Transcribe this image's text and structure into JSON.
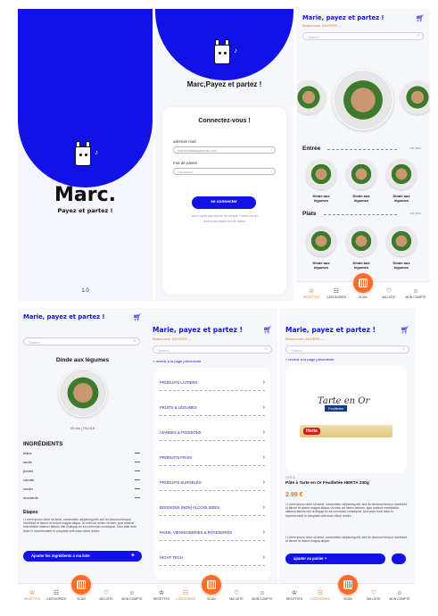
{
  "splash": {
    "brand": "Marc.",
    "tagline": "Payez et partez !",
    "version": "1.0"
  },
  "login": {
    "header_title": "Marc,Payez et partez !",
    "card_title": "Connectez-vous !",
    "email_label": "adresse mail",
    "email_value": "marcfantastiqueemail.com",
    "password_label": "mot de passe",
    "password_value": "•••••••••••••",
    "login_button": "se connecter",
    "link1": "vous n'avez pas encore de compte ? créez-en un",
    "link2": "avez-vous oublié mot de passe"
  },
  "header": {
    "title": "Marie, payez et partez !",
    "location": "Beaucouzé, ANGERS",
    "search_placeholder": "Search"
  },
  "home": {
    "section_entree": "Entrée",
    "section_plats": "Plats",
    "see_all": "voir plus",
    "dish_name": "Dinde aux légumes"
  },
  "nav": {
    "recettes": "RECETTES",
    "categories": "CATEGORIES",
    "scan": "SCAN",
    "ma_liste": "MA LISTE",
    "mon_compte": "MON COMPTE"
  },
  "recipe": {
    "title": "Dinde aux légumes",
    "meta": "45 min | FACILE",
    "ingredients_title": "INGRÉDIENTS",
    "ingredients": [
      "blanc",
      "oeufs",
      "poulet",
      "carotte",
      "cumin",
      "moutarde"
    ],
    "steps_title": "Etapes",
    "steps_text": "• Lorem ipsum dolor sit amet, consectetur adipiscing elit, sed do eiusmod tempor incididunt ut labore et dolore magna aliqua. Ut enim ad minim veniam, quis nostrud exercitation ullamco laboris nisi ut aliquip ex ea commodo consequat. Duis aute irure dolor in reprehenderit in voluptate velit esse cillum dolore.",
    "add_button": "Ajouter les ingrédients à ma liste"
  },
  "categories": {
    "back_link": "< revenir à la page précedente",
    "items": [
      "PRODUITS LAITIERS",
      "FRUITS & LÉGUMES",
      "VIANDES & POISSONS",
      "PRODUITS FRAIS",
      "PRODUITS SURGELÉS",
      "BOISSONS (NON) ALCOOLISÉES",
      "PAINS, VIENNOISERIES & PATISSERIES",
      "HIGHT TECH"
    ]
  },
  "product": {
    "back_link": "< revenir à la page précedente",
    "image_title": "Tarte en Or",
    "image_sub": "Feuilletée",
    "image_brand": "Herta",
    "brand_small": "HERTA",
    "name": "Pâte à Tarte en Or Feuilletée HERTA 230g",
    "price": "2.99 €",
    "desc1": "• Lorem ipsum dolor sit amet, consectetur adipiscing elit, sed do eiusmod tempor incididunt ut labore et dolore magna aliqua. Ut enim ad minim veniam, quis nostrud exercitation ullamco laboris nisi ut aliquip ex ea commodo consequat. Duis aute irure dolor in reprehenderit in voluptate velit esse cillum dolore.",
    "desc2": "• Lorem ipsum dolor sit amet, consectetur adipiscing elit, sed do eiusmod tempor incididunt ut labore et dolore magna aliqua.",
    "add_button": "ajouter au panier +"
  },
  "colors": {
    "primary": "#1212e6",
    "accent": "#e8752a",
    "scan": "#ff6b2b"
  },
  "icons": {
    "cart": "cart-icon",
    "search": "search-icon",
    "chevron": "chevron-right-icon",
    "scan": "barcode-icon"
  }
}
